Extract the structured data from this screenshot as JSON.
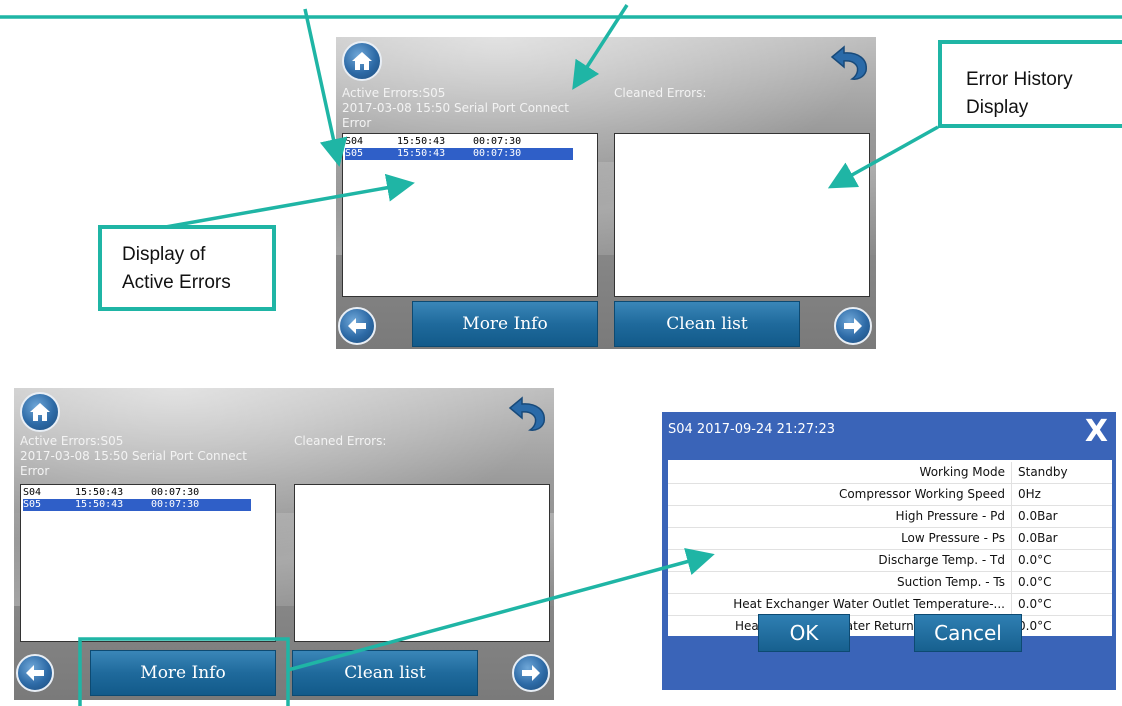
{
  "annotations": {
    "active_errors": [
      "Display of",
      "Active Errors"
    ],
    "history": [
      "Error History",
      "Display"
    ]
  },
  "screen": {
    "active_label": "Active Errors:S05",
    "active_message_line1": "2017-03-08 15:50 Serial Port Connect",
    "active_message_line2": "Error",
    "cleaned_label": "Cleaned Errors:",
    "errors": [
      {
        "code": "S04",
        "time": "15:50:43",
        "duration": "00:07:30"
      },
      {
        "code": "S05",
        "time": "15:50:43",
        "duration": "00:07:30"
      }
    ],
    "more_info": "More Info",
    "clean_list": "Clean list"
  },
  "dialog": {
    "title": "S04 2017-09-24 21:27:23",
    "close": "X",
    "rows": [
      {
        "label": "Working Mode",
        "value": "Standby"
      },
      {
        "label": "Compressor Working Speed",
        "value": "0Hz"
      },
      {
        "label": "High Pressure - Pd",
        "value": "0.0Bar"
      },
      {
        "label": "Low Pressure - Ps",
        "value": "0.0Bar"
      },
      {
        "label": "Discharge Temp. - Td",
        "value": "0.0°C"
      },
      {
        "label": "Suction Temp. - Ts",
        "value": "0.0°C"
      },
      {
        "label": "Heat Exchanger Water Outlet Temperature-...",
        "value": "0.0°C"
      },
      {
        "label": "Heat Exchanger Water Return Temperature...",
        "value": "0.0°C"
      }
    ],
    "ok": "OK",
    "cancel": "Cancel"
  },
  "colors": {
    "annotation": "#1fb5a5",
    "selection": "#2f5fc8",
    "button": "#1f6a9c",
    "dialog": "#3a64b8"
  }
}
